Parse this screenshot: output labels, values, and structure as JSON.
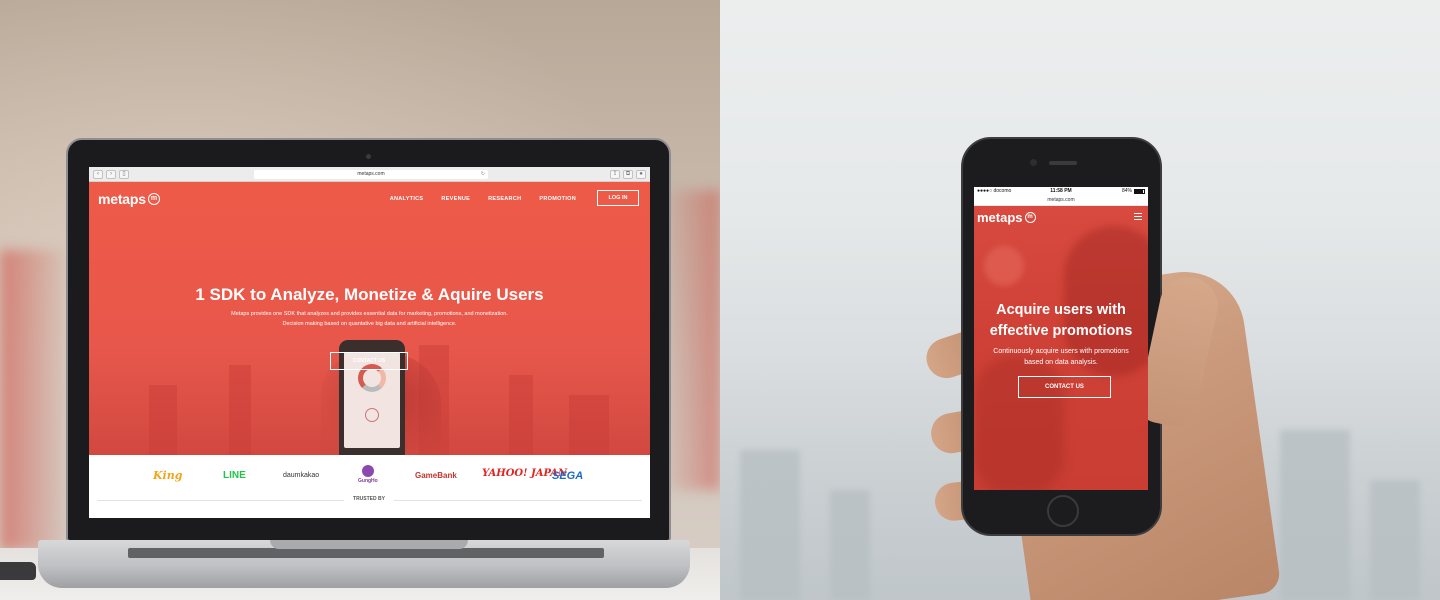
{
  "desktop": {
    "browser": {
      "url": "metaps.com"
    },
    "logo_text": "metaps",
    "logo_mark": "m",
    "nav": [
      "ANALYTICS",
      "REVENUE",
      "RESEARCH",
      "PROMOTION"
    ],
    "login_label": "LOG IN",
    "hero_title": "1 SDK to Analyze, Monetize & Aquire Users",
    "hero_subtitle_line1": "Metaps provides one SDK that analyzes and provides essential data for marketing, promotions, and monetization.",
    "hero_subtitle_line2": "Decision making based on quantative big data and artificial intelligence.",
    "contact_label": "CONTACT US",
    "partner_logos": [
      "King",
      "LINE",
      "daumkakao",
      "GungHo",
      "GameBank",
      "YAHOO! JAPAN",
      "SEGA"
    ],
    "trusted_label": "TRUSTED BY",
    "colors": {
      "brand_red": "#ee5a48"
    }
  },
  "mobile": {
    "status": {
      "carrier": "docomo",
      "time": "11:58 PM",
      "battery": "84%"
    },
    "url": "metaps.com",
    "logo_text": "metaps",
    "logo_mark": "m",
    "hero_title_line1": "Acquire users with",
    "hero_title_line2": "effective promotions",
    "hero_subtitle_line1": "Continuously acquire users with promotions",
    "hero_subtitle_line2": "based on data analysis.",
    "contact_label": "CONTACT US",
    "colors": {
      "hero_red": "#d84a3f"
    }
  }
}
